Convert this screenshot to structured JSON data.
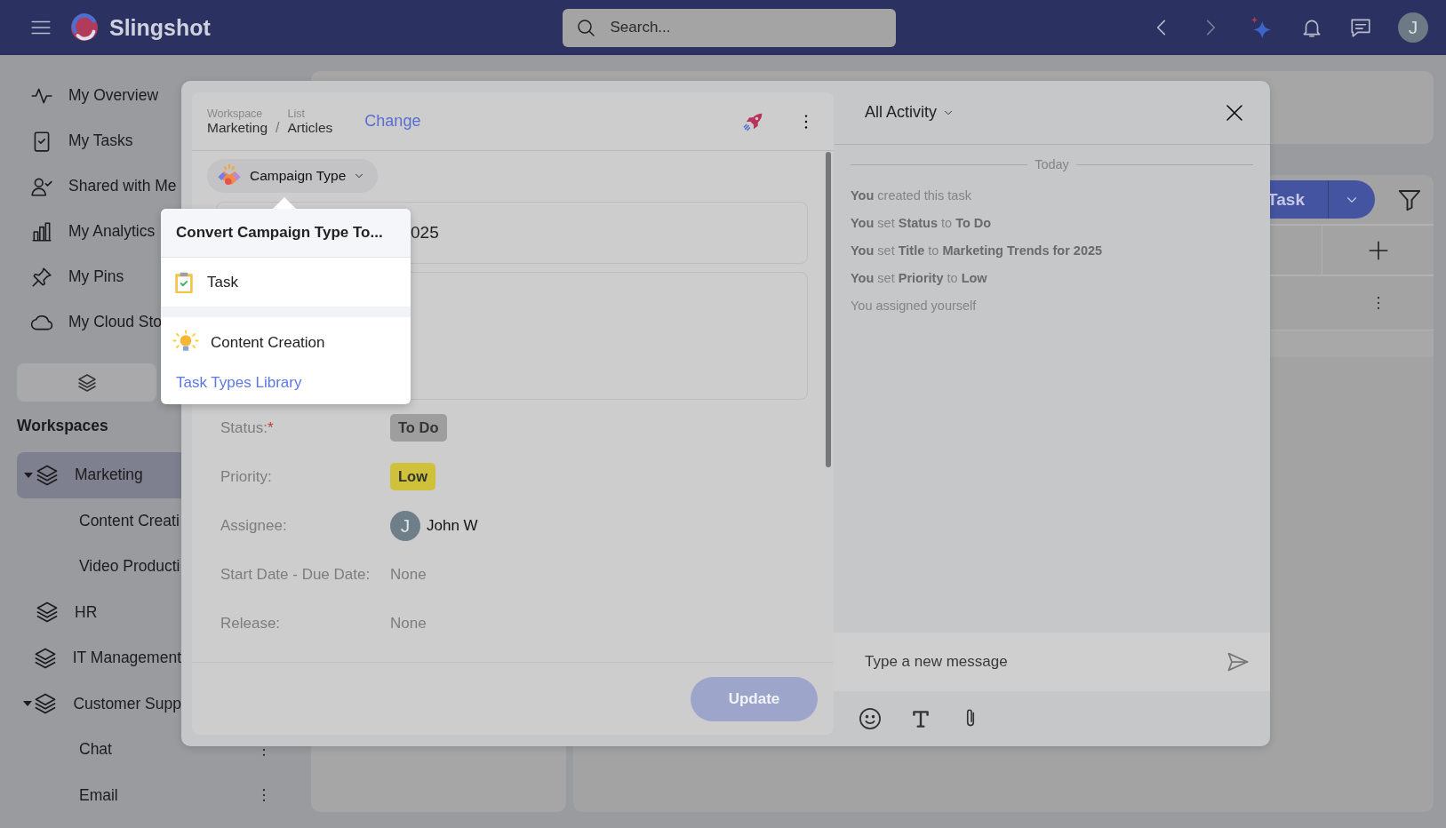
{
  "topbar": {
    "brand": "Slingshot",
    "search": {
      "placeholder": "Search..."
    },
    "avatar": "J"
  },
  "sidebar": {
    "nav": [
      {
        "label": "My Overview"
      },
      {
        "label": "My Tasks"
      },
      {
        "label": "Shared with Me"
      },
      {
        "label": "My Analytics"
      },
      {
        "label": "My Pins"
      },
      {
        "label": "My Cloud Sto"
      }
    ],
    "workspaces_heading": "Workspaces",
    "workspaces": [
      {
        "label": "Marketing",
        "selected": true,
        "expanded": true,
        "children": [
          {
            "label": "Content Creati"
          },
          {
            "label": "Video Producti"
          }
        ]
      },
      {
        "label": "HR",
        "selected": false,
        "expanded": false
      },
      {
        "label": "IT Management",
        "selected": false,
        "expanded": false
      },
      {
        "label": "Customer Supp",
        "selected": false,
        "expanded": true,
        "children": [
          {
            "label": "Chat"
          },
          {
            "label": "Email"
          }
        ]
      }
    ]
  },
  "board": {
    "new_button": "Task"
  },
  "task_dialog": {
    "breadcrumb": {
      "workspace_label": "Workspace",
      "workspace": "Marketing",
      "separator": "/",
      "list_label": "List",
      "list": "Articles"
    },
    "change_link": "Change",
    "task_type": "Campaign Type",
    "title_field": {
      "value": "025"
    },
    "fields": [
      {
        "label": "Status:",
        "required_mark": "*",
        "kind": "badge",
        "value": "To Do",
        "color": "#9e9e9e"
      },
      {
        "label": "Priority:",
        "kind": "badge",
        "value": "Low",
        "color": "#cfc23a"
      },
      {
        "label": "Assignee:",
        "kind": "user",
        "value": "John W",
        "avatar": "J"
      },
      {
        "label": "Start Date - Due Date:",
        "kind": "text",
        "value": "None"
      },
      {
        "label": "Release:",
        "kind": "text",
        "value": "None"
      }
    ],
    "update_button": {
      "label": "Update",
      "disabled": true
    }
  },
  "activity": {
    "filter": "All Activity",
    "day": "Today",
    "entries": [
      "**You** created this task",
      "**You** set **Status** to **To Do**",
      "**You** set **Title** to **Marketing Trends for 2025**",
      "**You** set **Priority** to **Low**",
      "You assigned yourself"
    ],
    "message": {
      "placeholder": "Type a new message"
    }
  },
  "convert_menu": {
    "title": "Convert Campaign Type To...",
    "options": [
      {
        "label": "Task"
      },
      {
        "label": "Content Creation"
      }
    ],
    "library_link": "Task Types Library"
  }
}
